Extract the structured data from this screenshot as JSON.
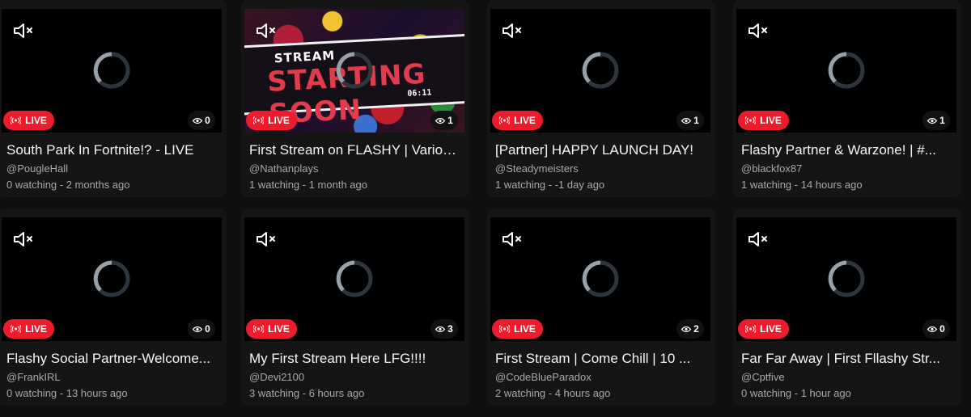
{
  "streams": [
    {
      "title": "South Park In Fortnite!? - LIVE",
      "channel": "@PougleHall",
      "watching": "0 watching",
      "age": "2 months ago",
      "viewers": "0",
      "live": "LIVE",
      "thumbnail": "black"
    },
    {
      "title": "First Stream on FLASHY | Various Games",
      "channel": "@Nathanplays",
      "watching": "1 watching",
      "age": "1 month ago",
      "viewers": "1",
      "live": "LIVE",
      "thumbnail": "stream-starting-soon"
    },
    {
      "title": "[Partner] HAPPY LAUNCH DAY!",
      "channel": "@Steadymeisters",
      "watching": "1 watching",
      "age": "-1 day ago",
      "viewers": "1",
      "live": "LIVE",
      "thumbnail": "black"
    },
    {
      "title": "Flashy Partner & Warzone! | #...",
      "channel": "@blackfox87",
      "watching": "1 watching",
      "age": "14 hours ago",
      "viewers": "1",
      "live": "LIVE",
      "thumbnail": "black"
    },
    {
      "title": "Flashy Social Partner-Welcome...",
      "channel": "@FrankIRL",
      "watching": "0 watching",
      "age": "13 hours ago",
      "viewers": "0",
      "live": "LIVE",
      "thumbnail": "black"
    },
    {
      "title": "My First Stream Here LFG!!!!",
      "channel": "@Devi2100",
      "watching": "3 watching",
      "age": "6 hours ago",
      "viewers": "3",
      "live": "LIVE",
      "thumbnail": "black"
    },
    {
      "title": "First Stream | Come Chill | 10 ...",
      "channel": "@CodeBlueParadox",
      "watching": "2 watching",
      "age": "4 hours ago",
      "viewers": "2",
      "live": "LIVE",
      "thumbnail": "black"
    },
    {
      "title": "Far Far Away | First Fllashy Str...",
      "channel": "@Cptfive",
      "watching": "0 watching",
      "age": "1 hour ago",
      "viewers": "0",
      "live": "LIVE",
      "thumbnail": "black"
    }
  ],
  "thumbnail_art": {
    "line1": "STREAM",
    "line2": "STARTING SOON",
    "timer": "06:11"
  },
  "separator": " - ",
  "icons": {
    "mute": "muted-speaker-icon",
    "live": "broadcast-icon",
    "viewers": "eye-icon",
    "loading": "loading-spinner-icon"
  },
  "colors": {
    "background": "#0f0f0f",
    "card": "#151515",
    "live_badge": "#ec1c2d",
    "text": "#f5f5f5",
    "secondary_text": "#a8a8a8"
  }
}
